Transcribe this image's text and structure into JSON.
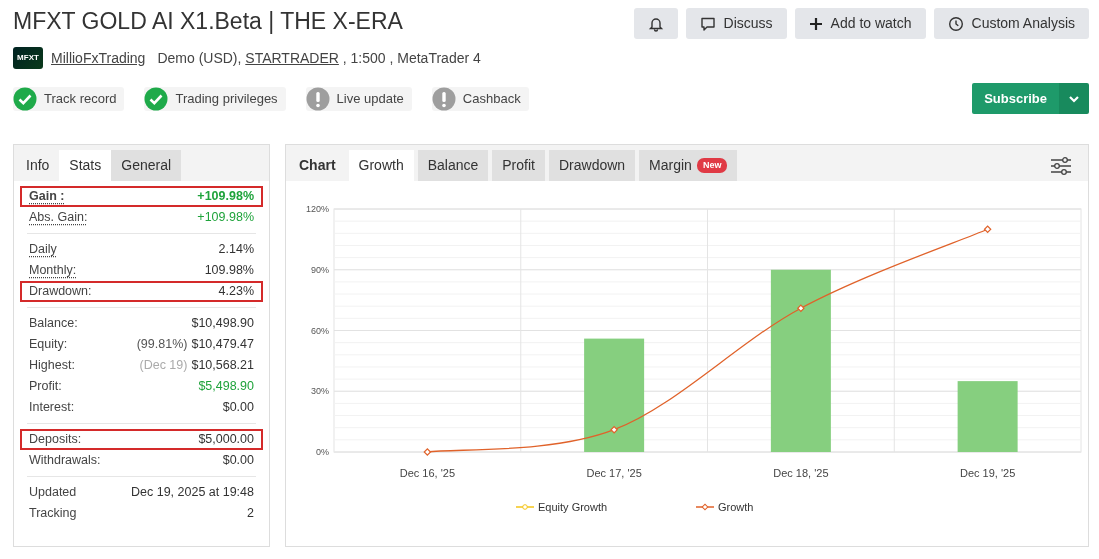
{
  "title": "MFXT GOLD AI X1.Beta | THE X-ERA",
  "header_buttons": [
    {
      "kind": "bell"
    },
    {
      "kind": "chat",
      "label": "Discuss"
    },
    {
      "kind": "plus",
      "label": "Add to watch"
    },
    {
      "kind": "clock",
      "label": "Custom Analysis"
    }
  ],
  "account": {
    "logo_text": "MFXT",
    "owner": "MillioFxTrading",
    "type": "Demo (USD),",
    "broker": "STARTRADER",
    "details": ", 1:500 , MetaTrader 4"
  },
  "badges": [
    {
      "label": "Track record",
      "verified": true
    },
    {
      "label": "Trading privileges",
      "verified": true
    },
    {
      "label": "Live update",
      "verified": false
    },
    {
      "label": "Cashback",
      "verified": false
    }
  ],
  "subscribe": {
    "label": "Subscribe"
  },
  "stats_tabs": [
    {
      "label": "Info",
      "selected": false,
      "shaded": false
    },
    {
      "label": "Stats",
      "selected": true,
      "shaded": false
    },
    {
      "label": "General",
      "selected": false,
      "shaded": true
    }
  ],
  "stats_groups": [
    [
      {
        "label": "Gain :",
        "value": "+109.98%",
        "positive": true,
        "dotted": true,
        "bold": true,
        "highlighted": true
      },
      {
        "label": "Abs. Gain:",
        "value": "+109.98%",
        "positive": true,
        "dotted": true,
        "bold": false,
        "highlighted": false
      }
    ],
    [
      {
        "label": "Daily",
        "value": "2.14%",
        "positive": false,
        "dotted": true,
        "bold": false,
        "highlighted": false
      },
      {
        "label": "Monthly:",
        "value": "109.98%",
        "positive": false,
        "dotted": true,
        "bold": false,
        "highlighted": false
      },
      {
        "label": "Drawdown:",
        "value": "4.23%",
        "positive": false,
        "dotted": false,
        "bold": false,
        "highlighted": true
      }
    ],
    [
      {
        "label": "Balance:",
        "value": "$10,498.90",
        "positive": false,
        "dotted": false,
        "bold": false,
        "highlighted": false
      },
      {
        "label": "Equity:",
        "note": "(99.81%)",
        "value": "$10,479.47",
        "positive": false,
        "dotted": false,
        "bold": false,
        "highlighted": false
      },
      {
        "label": "Highest:",
        "note": "(Dec 19)",
        "value": "$10,568.21",
        "positive": false,
        "dotted": false,
        "bold": false,
        "highlighted": false
      },
      {
        "label": "Profit:",
        "value": "$5,498.90",
        "positive": true,
        "dotted": false,
        "bold": false,
        "highlighted": false
      },
      {
        "label": "Interest:",
        "value": "$0.00",
        "positive": false,
        "dotted": false,
        "bold": false,
        "highlighted": false
      }
    ],
    [
      {
        "label": "Deposits:",
        "value": "$5,000.00",
        "positive": false,
        "dotted": false,
        "bold": false,
        "highlighted": true
      },
      {
        "label": "Withdrawals:",
        "value": "$0.00",
        "positive": false,
        "dotted": false,
        "bold": false,
        "highlighted": false
      }
    ],
    [
      {
        "label": "Updated",
        "value": "Dec 19, 2025 at 19:48",
        "positive": false,
        "dotted": false,
        "bold": false,
        "highlighted": false
      },
      {
        "label": "Tracking",
        "value": "2",
        "positive": false,
        "dotted": false,
        "bold": false,
        "highlighted": false
      }
    ]
  ],
  "chart_panel": {
    "heading": "Chart",
    "tabs": [
      {
        "label": "Growth",
        "selected": true
      },
      {
        "label": "Balance",
        "selected": false
      },
      {
        "label": "Profit",
        "selected": false
      },
      {
        "label": "Drawdown",
        "selected": false
      },
      {
        "label": "Margin",
        "selected": false,
        "badge": "New"
      }
    ],
    "chart_data": {
      "type": "line",
      "categories": [
        "Dec 16, '25",
        "Dec 17, '25",
        "Dec 18, '25",
        "Dec 19, '25"
      ],
      "ylim": [
        0,
        120
      ],
      "grid": true,
      "yticks": [
        {
          "value": 0,
          "label": "0%"
        },
        {
          "value": 30,
          "label": "30%"
        },
        {
          "value": 60,
          "label": "60%"
        },
        {
          "value": 90,
          "label": "90%"
        },
        {
          "value": 120,
          "label": "120%"
        }
      ],
      "series": [
        {
          "type": "bar",
          "color": "#86cf7f",
          "values": [
            null,
            56,
            90,
            35
          ]
        },
        {
          "name": "Equity Growth",
          "color": "#f5c518",
          "marker": "circle",
          "values": [
            null,
            null,
            null,
            null
          ]
        },
        {
          "name": "Growth",
          "color": "#e0622a",
          "marker": "diamond",
          "values": [
            0,
            11,
            71,
            110
          ]
        }
      ]
    }
  }
}
